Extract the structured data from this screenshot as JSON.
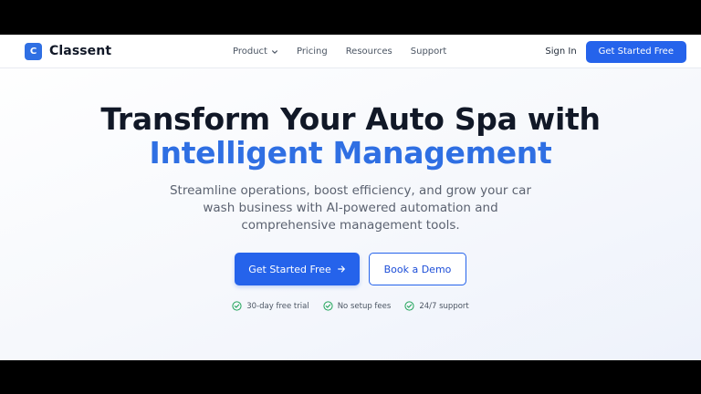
{
  "brand": {
    "logo_letter": "C",
    "name": "Classent",
    "accent_color": "#2f6fe3"
  },
  "nav": {
    "links": [
      {
        "label": "Product",
        "has_dropdown": true
      },
      {
        "label": "Pricing"
      },
      {
        "label": "Resources"
      },
      {
        "label": "Support"
      }
    ],
    "sign_in": "Sign In",
    "cta": "Get Started Free"
  },
  "hero": {
    "title_line1": "Transform Your Auto Spa with",
    "title_line2": "Intelligent Management",
    "subtitle": "Streamline operations, boost efficiency, and grow your car wash business with AI-powered automation and comprehensive management tools.",
    "primary_cta": "Get Started Free",
    "secondary_cta": "Book a Demo",
    "features": [
      "30-day free trial",
      "No setup fees",
      "24/7 support"
    ]
  },
  "icons": {
    "chevron": "chevron-down-icon",
    "arrow": "arrow-right-icon",
    "check": "check-circle-icon"
  }
}
